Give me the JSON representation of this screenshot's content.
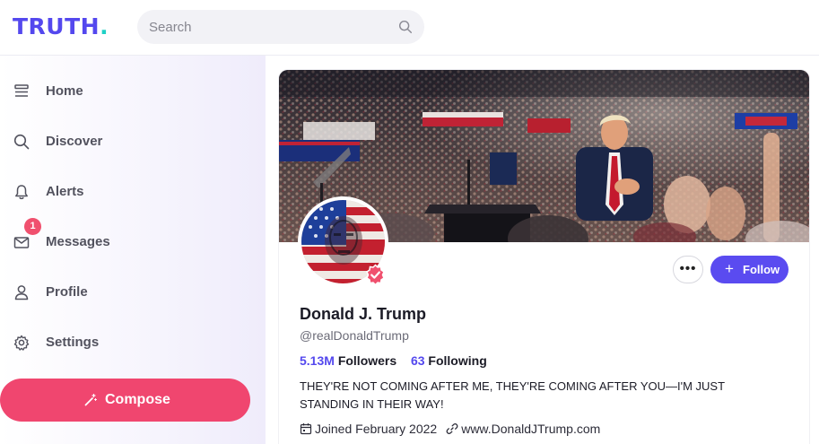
{
  "app": {
    "logo_text": "TRUTH",
    "logo_dot": ".",
    "brand_color": "#5448ee",
    "accent_color": "#1fd1c6"
  },
  "search": {
    "placeholder": "Search",
    "icon": "search-icon"
  },
  "sidebar": {
    "items": [
      {
        "label": "Home",
        "icon": "home-icon"
      },
      {
        "label": "Discover",
        "icon": "search-icon"
      },
      {
        "label": "Alerts",
        "icon": "bell-icon"
      },
      {
        "label": "Messages",
        "icon": "envelope-icon",
        "badge": "1"
      },
      {
        "label": "Profile",
        "icon": "user-icon"
      },
      {
        "label": "Settings",
        "icon": "gear-icon"
      }
    ],
    "compose_label": "Compose",
    "compose_icon": "magic-wand-icon",
    "compose_color": "#f0466f"
  },
  "profile": {
    "name": "Donald J. Trump",
    "handle": "@realDonaldTrump",
    "followers_count": "5.13M",
    "followers_label": "Followers",
    "following_count": "63",
    "following_label": "Following",
    "bio": "THEY'RE NOT COMING AFTER ME, THEY'RE COMING AFTER YOU—I'M JUST STANDING IN THEIR WAY!",
    "joined": "Joined February 2022",
    "website": "www.DonaldJTrump.com",
    "follow_label": "Follow",
    "more_label": "•••",
    "verified_color": "#f0506e",
    "follow_color": "#5a4bf0"
  }
}
